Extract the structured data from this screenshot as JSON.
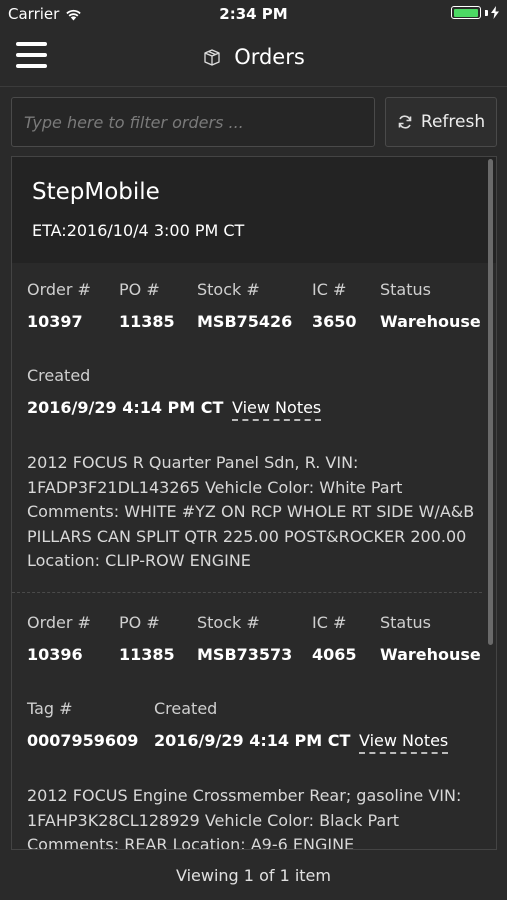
{
  "status_bar": {
    "carrier": "Carrier",
    "time": "2:34 PM",
    "battery_level": 1.0,
    "battery_color": "#4cd964"
  },
  "nav": {
    "title": "Orders",
    "title_icon": "box-icon",
    "menu_icon": "hamburger-icon"
  },
  "filter": {
    "placeholder": "Type here to filter orders ...",
    "value": ""
  },
  "refresh": {
    "label": "Refresh",
    "icon": "refresh-icon"
  },
  "customer": {
    "name": "StepMobile",
    "eta": "ETA:2016/10/4 3:00 PM CT"
  },
  "orders": [
    {
      "labels": {
        "order": "Order #",
        "po": "PO #",
        "stock": "Stock #",
        "ic": "IC #",
        "status": "Status",
        "created": "Created"
      },
      "order_no": "10397",
      "po_no": "11385",
      "stock_no": "MSB75426",
      "ic_no": "3650",
      "status": "Warehouse",
      "created": "2016/9/29 4:14 PM CT",
      "notes_link": "View Notes",
      "description": "2012 FOCUS R Quarter Panel Sdn, R. VIN: 1FADP3F21DL143265 Vehicle Color: White Part Comments: WHITE #YZ ON RCP WHOLE RT SIDE W/A&B PILLARS CAN SPLIT QTR 225.00 POST&ROCKER 200.00 Location: CLIP-ROW ENGINE"
    },
    {
      "labels": {
        "order": "Order #",
        "po": "PO #",
        "stock": "Stock #",
        "ic": "IC #",
        "status": "Status",
        "tag": "Tag #",
        "created": "Created"
      },
      "order_no": "10396",
      "po_no": "11385",
      "stock_no": "MSB73573",
      "ic_no": "4065",
      "status": "Warehouse",
      "tag_no": "0007959609",
      "created": "2016/9/29 4:14 PM CT",
      "notes_link": "View Notes",
      "description": "2012 FOCUS Engine Crossmember Rear; gasoline VIN: 1FAHP3K28CL128929 Vehicle Color: Black Part Comments: REAR Location: A9-6 ENGINE"
    }
  ],
  "footer": {
    "text": "Viewing 1 of 1 item"
  }
}
